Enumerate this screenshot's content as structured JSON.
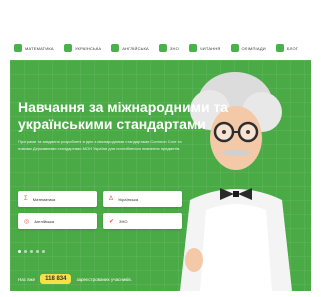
{
  "nav": {
    "items": [
      {
        "label": "МАТЕМАТИКА",
        "icon": "math-icon"
      },
      {
        "label": "УКРАЇНСЬКА",
        "icon": "book-icon"
      },
      {
        "label": "АНГЛІЙСЬКА",
        "icon": "language-icon"
      },
      {
        "label": "ЗНО",
        "icon": "exam-icon"
      },
      {
        "label": "ЧИТАННЯ",
        "icon": "reading-icon"
      },
      {
        "label": "ОЛІМПІАДИ",
        "icon": "trophy-icon"
      },
      {
        "label": "БЛОГ",
        "icon": "blog-icon"
      }
    ]
  },
  "hero": {
    "title": "Навчання за міжнародними та українськими стандартами",
    "description": "Програми та завдання розроблені згідно з міжнародними стандартами Common Core та новими Державними стандартами МОН України для поглибленого вивчення предметів.",
    "cards": [
      {
        "label": "Математика",
        "icon": "sigma-icon"
      },
      {
        "label": "Українська",
        "icon": "letter-icon"
      },
      {
        "label": "Англійська",
        "icon": "globe-icon"
      },
      {
        "label": "ЗНО",
        "icon": "check-icon"
      }
    ]
  },
  "stats": {
    "prefix": "Нас вже",
    "count": "118 834",
    "suffix": "зареєстрованих учасників."
  },
  "colors": {
    "green": "#4aab46",
    "accent_yellow": "#f7df46",
    "icon_orange": "#e35d3f"
  }
}
